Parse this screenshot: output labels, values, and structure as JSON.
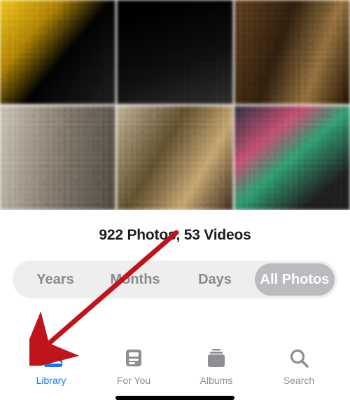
{
  "stats": {
    "photos_count": 922,
    "videos_count": 53,
    "display": "922 Photos, 53 Videos"
  },
  "segments": {
    "years": "Years",
    "months": "Months",
    "days": "Days",
    "all_photos": "All Photos",
    "active": "all_photos"
  },
  "tabs": {
    "library": "Library",
    "for_you": "For You",
    "albums": "Albums",
    "search": "Search",
    "active": "library"
  },
  "colors": {
    "accent": "#0a7aff",
    "inactive": "#8e8e93",
    "seg_bg": "#eeeeef",
    "seg_active_bg": "#bababf",
    "annotation": "#c0141b"
  },
  "photo_tiles": [
    {
      "bg": "linear-gradient(130deg,#e6c22a 0%,#b08a10 30%,#0d0d0d 55%,#2a2a2a 100%)"
    },
    {
      "bg": "linear-gradient(160deg,#050505 0%,#1a1a1a 60%,#3a3a3a 100%)"
    },
    {
      "bg": "linear-gradient(110deg,#6a4a2a 0%,#3a2a1a 40%,#9a7a4a 70%,#2a1a0a 100%)"
    },
    {
      "bg": "linear-gradient(100deg,#c6bfb4 0%,#8a8276 50%,#5a5248 100%)"
    },
    {
      "bg": "linear-gradient(120deg,#bfb29a 0%,#6a5a3a 40%,#c2a87a 70%,#4a3a2a 100%)"
    },
    {
      "bg": "linear-gradient(140deg,#3a3a4a 0%,#c25a7a 30%,#3aa27a 50%,#2a2a2a 80%)"
    }
  ]
}
